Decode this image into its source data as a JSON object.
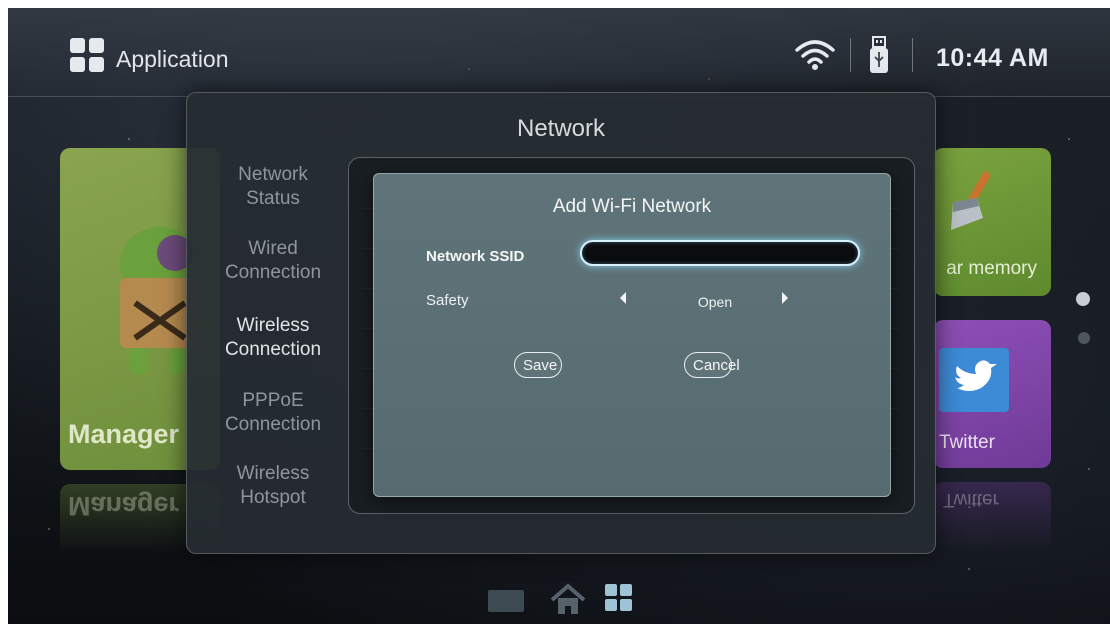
{
  "statusbar": {
    "app_title": "Application",
    "time": "10:44 AM",
    "icons": [
      "app-grid-icon",
      "wifi-icon",
      "usb-icon"
    ]
  },
  "background_tiles": {
    "manager_label": "Manager",
    "clear_memory_label": "ar memory",
    "twitter_label": "Twitter"
  },
  "network_panel": {
    "title": "Network",
    "nav_items": [
      {
        "label_line1": "Network",
        "label_line2": "Status",
        "active": false
      },
      {
        "label_line1": "Wired",
        "label_line2": "Connection",
        "active": false
      },
      {
        "label_line1": "Wireless",
        "label_line2": "Connection",
        "active": true
      },
      {
        "label_line1": "PPPoE",
        "label_line2": "Connection",
        "active": false
      },
      {
        "label_line1": "Wireless",
        "label_line2": "Hotspot",
        "active": false
      }
    ]
  },
  "dialog": {
    "title": "Add Wi-Fi Network",
    "ssid_label": "Network SSID",
    "ssid_value": "",
    "safety_label": "Safety",
    "safety_value": "Open",
    "save_label": "Save",
    "cancel_label": "Cancel"
  },
  "dock": {
    "icons": [
      "tv-icon",
      "home-icon",
      "apps-icon"
    ],
    "active": "apps-icon"
  },
  "colors": {
    "dialog_bg": "#5a6f73",
    "input_glow": "#8cdcff",
    "tile_green": "#7a9a45",
    "tile_purple": "#7e45a6"
  }
}
